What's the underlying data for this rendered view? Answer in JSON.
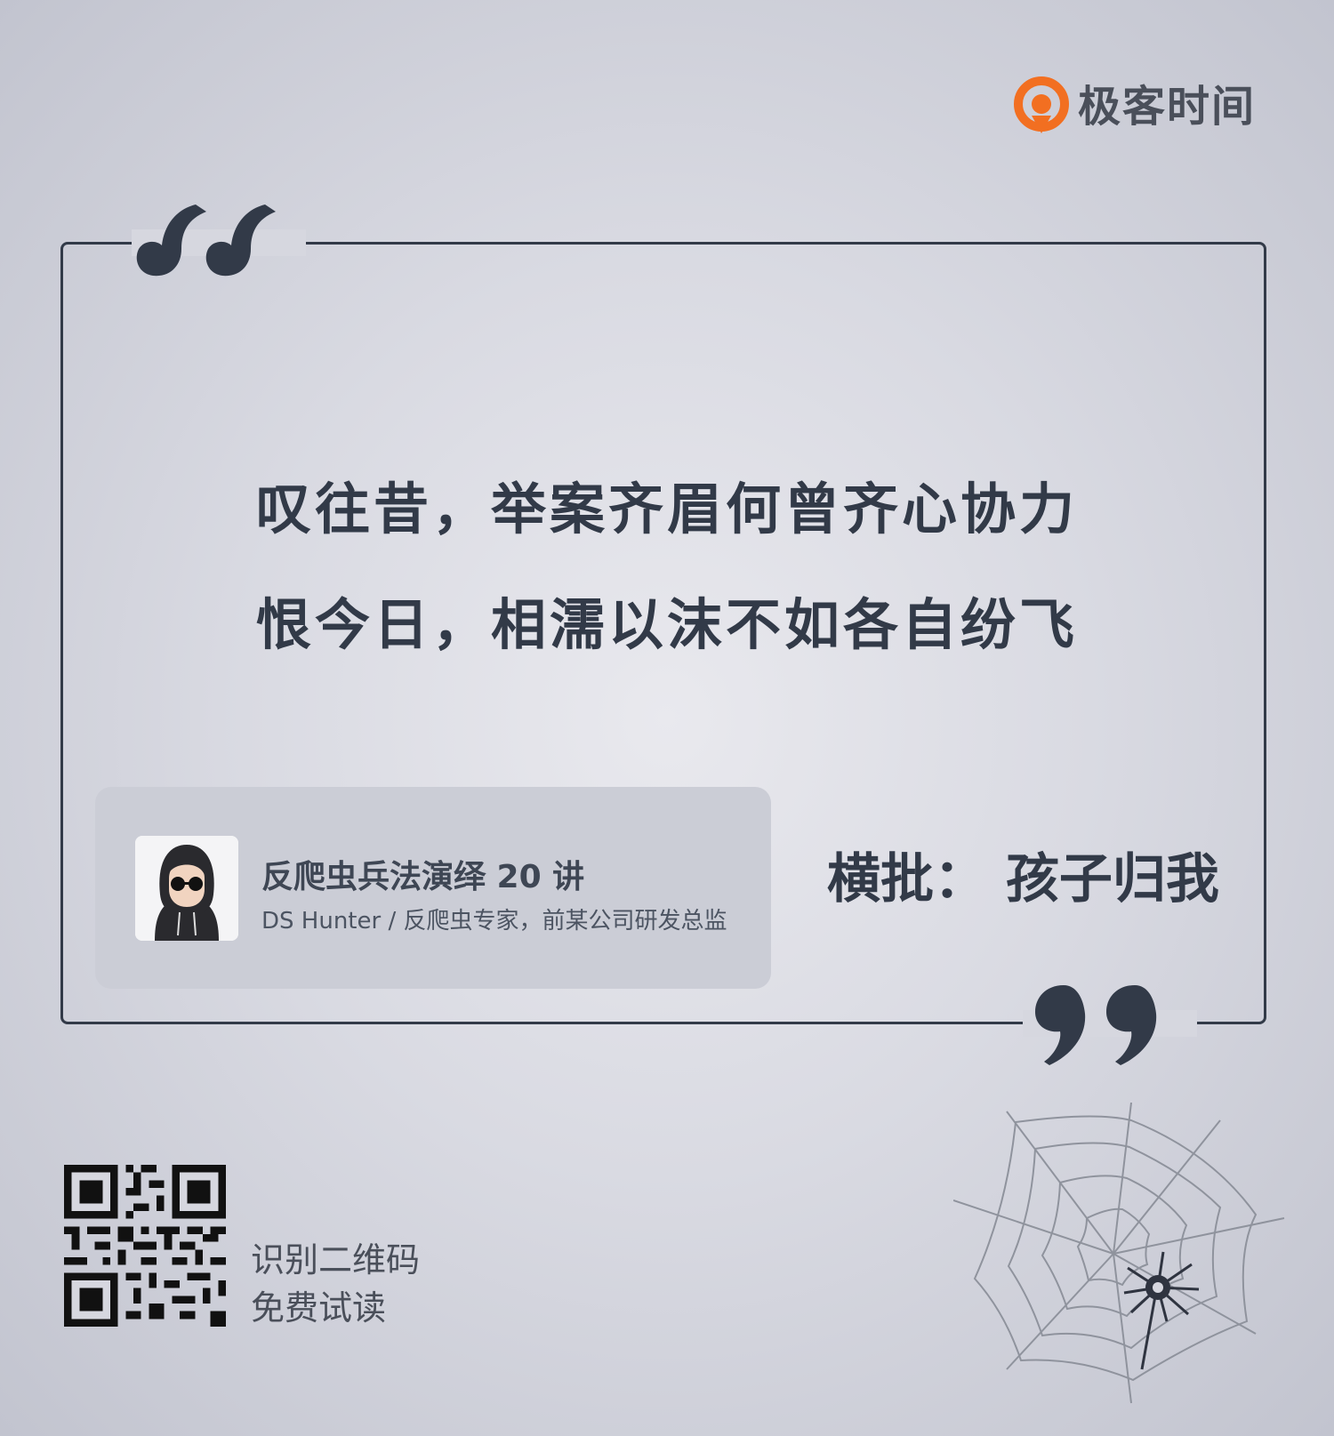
{
  "brand": {
    "name": "极客时间",
    "accent": "#f26f21"
  },
  "quote": {
    "lines": [
      "叹往昔，举案齐眉何曾齐心协力",
      "恨今日，相濡以沫不如各自纷飞"
    ]
  },
  "course": {
    "title": "反爬虫兵法演绎 20 讲",
    "author": "DS Hunter / 反爬虫专家，前某公司研发总监"
  },
  "banner": {
    "text": "横批：  孩子归我"
  },
  "qr": {
    "lines": [
      "识别二维码",
      "免费试读"
    ]
  },
  "icons": {
    "logo": "geektime-logo-icon",
    "open_quote": "open-quote-icon",
    "close_quote": "close-quote-icon",
    "avatar": "hooded-avatar",
    "qr": "qr-code-icon",
    "decoration": "spider-web-icon"
  },
  "colors": {
    "text": "#323a48",
    "card": "#cbcdd6",
    "background": "#d9dae2"
  }
}
